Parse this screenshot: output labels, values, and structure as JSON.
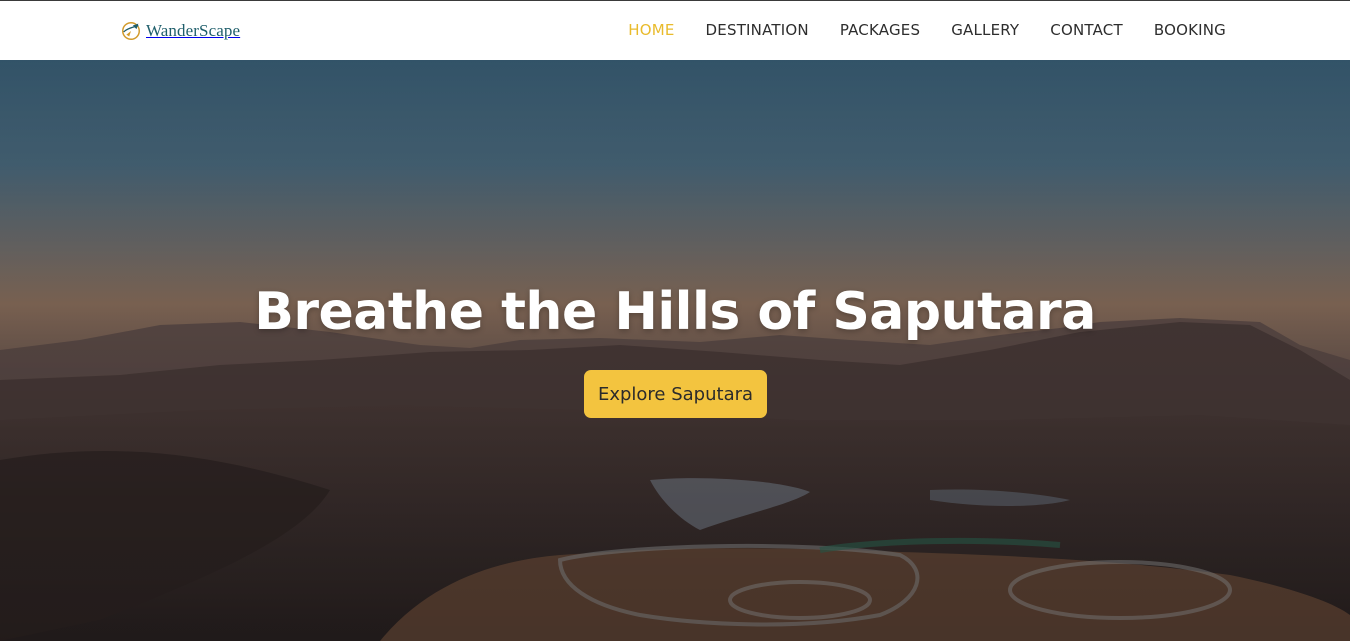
{
  "brand": {
    "name": "WanderScape",
    "logo_icon": "compass-plane-icon"
  },
  "nav": {
    "items": [
      {
        "label": "HOME",
        "active": true
      },
      {
        "label": "DESTINATION",
        "active": false
      },
      {
        "label": "PACKAGES",
        "active": false
      },
      {
        "label": "GALLERY",
        "active": false
      },
      {
        "label": "CONTACT",
        "active": false
      },
      {
        "label": "BOOKING",
        "active": false
      }
    ]
  },
  "hero": {
    "title": "Breathe the Hills of Saputara",
    "cta_label": "Explore Saputara",
    "image_subject": "dusk-hill-landscape-with-lake"
  },
  "colors": {
    "accent": "#f3c43f",
    "nav_active": "#e9bb2c",
    "nav_text": "#2d2d2d",
    "brand_text": "#1f5e6b"
  }
}
